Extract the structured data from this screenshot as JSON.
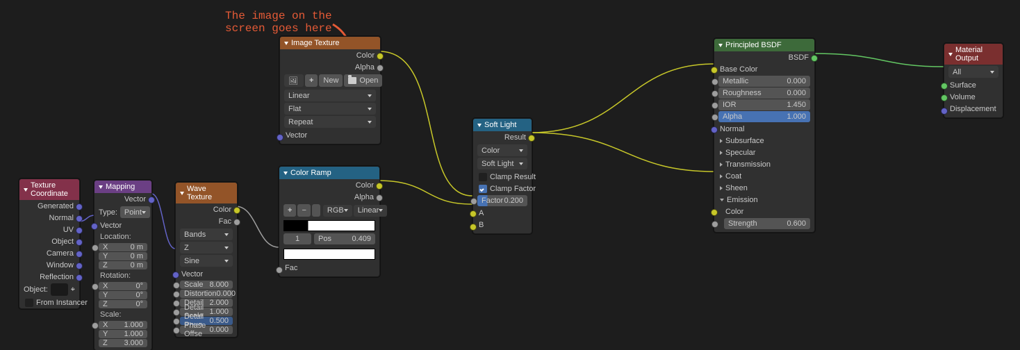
{
  "annotation": {
    "line1": "The image on the",
    "line2": "screen goes here"
  },
  "texCoord": {
    "title": "Texture Coordinate",
    "outputs": [
      "Generated",
      "Normal",
      "UV",
      "Object",
      "Camera",
      "Window",
      "Reflection"
    ],
    "objectLabel": "Object:",
    "fromInstancer": "From Instancer"
  },
  "mapping": {
    "title": "Mapping",
    "vectorOut": "Vector",
    "typeLabel": "Type:",
    "typeValue": "Point",
    "vectorIn": "Vector",
    "location": "Location:",
    "rotation": "Rotation:",
    "scale": "Scale:",
    "loc": [
      [
        "X",
        "0 m"
      ],
      [
        "Y",
        "0 m"
      ],
      [
        "Z",
        "0 m"
      ]
    ],
    "rot": [
      [
        "X",
        "0°"
      ],
      [
        "Y",
        "0°"
      ],
      [
        "Z",
        "0°"
      ]
    ],
    "scl": [
      [
        "X",
        "1.000"
      ],
      [
        "Y",
        "1.000"
      ],
      [
        "Z",
        "3.000"
      ]
    ]
  },
  "wave": {
    "title": "Wave Texture",
    "colorOut": "Color",
    "facOut": "Fac",
    "dd1": "Bands",
    "dd2": "Z",
    "dd3": "Sine",
    "vectorIn": "Vector",
    "params": [
      [
        "Scale",
        "8.000"
      ],
      [
        "Distortion",
        "0.000"
      ],
      [
        "Detail",
        "2.000"
      ],
      [
        "Detail Scale",
        "1.000"
      ],
      [
        "Detail Roug",
        "0.500"
      ],
      [
        "Phase Offse",
        "0.000"
      ]
    ]
  },
  "imgTex": {
    "title": "Image Texture",
    "colorOut": "Color",
    "alphaOut": "Alpha",
    "new": "New",
    "open": "Open",
    "dd1": "Linear",
    "dd2": "Flat",
    "dd3": "Repeat",
    "vectorIn": "Vector"
  },
  "colorRamp": {
    "title": "Color Ramp",
    "colorOut": "Color",
    "alphaOut": "Alpha",
    "mode": "RGB",
    "interp": "Linear",
    "stopIndex": "1",
    "posLabel": "Pos",
    "posValue": "0.409",
    "facIn": "Fac"
  },
  "softLight": {
    "title": "Soft Light",
    "resultOut": "Result",
    "dd1": "Color",
    "dd2": "Soft Light",
    "clampResult": "Clamp Result",
    "clampFactor": "Clamp Factor",
    "factorLabel": "Factor",
    "factorValue": "0.200",
    "aIn": "A",
    "bIn": "B"
  },
  "bsdf": {
    "title": "Principled BSDF",
    "bsdfOut": "BSDF",
    "baseColor": "Base Color",
    "params": [
      [
        "Metallic",
        "0.000"
      ],
      [
        "Roughness",
        "0.000"
      ],
      [
        "IOR",
        "1.450"
      ],
      [
        "Alpha",
        "1.000"
      ]
    ],
    "normal": "Normal",
    "groups": [
      "Subsurface",
      "Specular",
      "Transmission",
      "Coat",
      "Sheen",
      "Emission"
    ],
    "emColor": "Color",
    "emStrength": [
      "Strength",
      "0.600"
    ]
  },
  "output": {
    "title": "Material Output",
    "dd": "All",
    "ins": [
      "Surface",
      "Volume",
      "Displacement"
    ]
  }
}
